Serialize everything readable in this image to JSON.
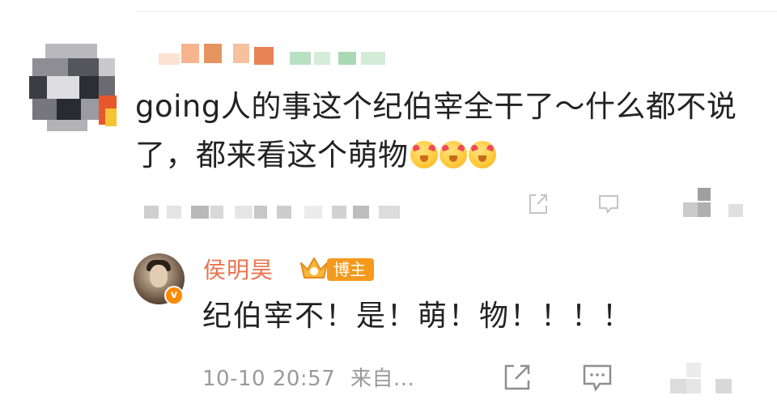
{
  "comment": {
    "text": "going人的事这个纪伯宰全干了～什么都不说了，都来看这个萌物",
    "emojis": [
      "heart-eyes-emoji",
      "heart-eyes-emoji",
      "heart-eyes-emoji"
    ]
  },
  "reply": {
    "author": "侯明昊",
    "role_badge": "博主",
    "text": "纪伯宰不！是！萌！物！！！！",
    "timestamp": "10-10 20:57",
    "source": "来自..."
  },
  "colors": {
    "author_name": "#eb7350",
    "badge": "#f39a1e",
    "meta_text": "#9a9a9a",
    "body_text": "#222222"
  },
  "icons": [
    "share-icon",
    "comment-icon",
    "like-icon",
    "crown-icon",
    "verified-icon"
  ]
}
